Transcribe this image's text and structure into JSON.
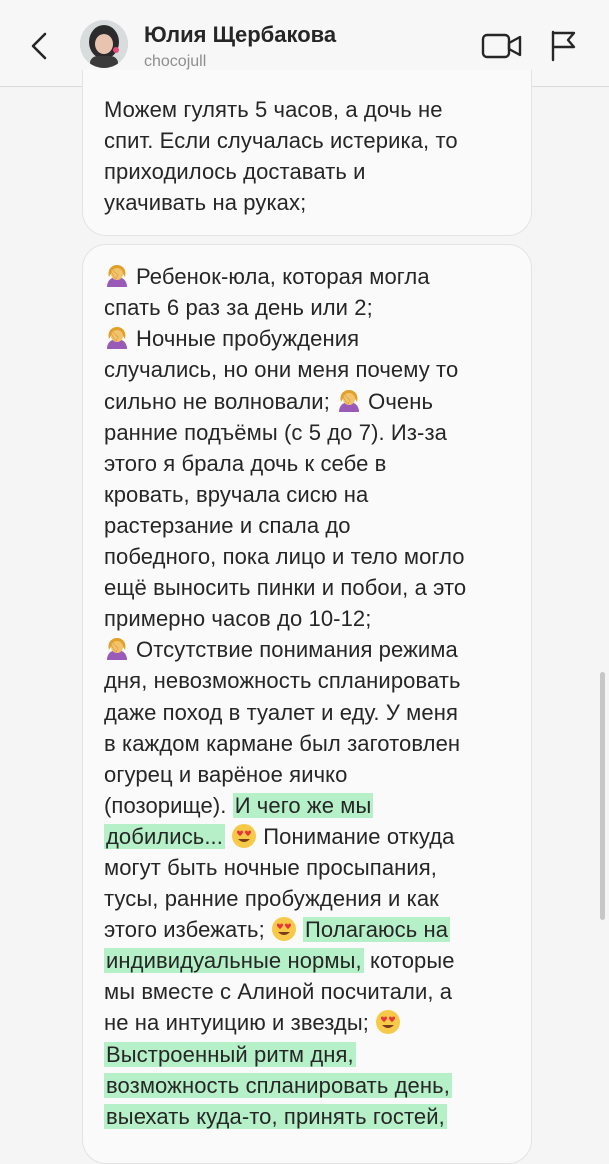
{
  "header": {
    "name": "Юлия Щербакова",
    "username": "chocojull"
  },
  "message1": {
    "lines": [
      "Можем гулять 5 часов, а дочь не",
      "спит. Если случалась истерика, то",
      "приходилось доставать и",
      "укачивать на руках;"
    ]
  },
  "message2": {
    "l1": "Ребенок-юла, которая могла",
    "l2": "спать 6 раз за день или 2;",
    "l3": "Ночные пробуждения",
    "l4": "случались, но они меня почему то",
    "l5a": "сильно не волновали;",
    "l5b": "Очень",
    "l6": "ранние подъёмы (с 5 до 7). Из-за",
    "l7": "этого я брала дочь к себе в",
    "l8": "кровать, вручала сисю на",
    "l9": "растерзание и спала до",
    "l10": "победного, пока лицо и тело могло",
    "l11": "ещё выносить пинки и побои, а это",
    "l12": "примерно часов до 10-12;",
    "l13": "Отсутствие понимания режима",
    "l14": "дня, невозможность спланировать",
    "l15": "даже поход в туалет и еду. У меня",
    "l16": "в каждом кармане был заготовлен",
    "l17": "огурец и варёное яичко",
    "l18a": "(позорище).",
    "l18b": "И чего же мы",
    "l19a": "добились...",
    "l19b": "Понимание откуда",
    "l20": "могут быть ночные просыпания,",
    "l21": "тусы, ранние пробуждения и как",
    "l22a": "этого избежать;",
    "l22b": "Полагаюсь на",
    "l23a": "индивидуальные нормы,",
    "l23b": "которые",
    "l24": "мы вместе с Алиной посчитали, а",
    "l25": "не на интуицию и звезды;",
    "l26": "Выстроенный ритм дня,",
    "l27": "возможность спланировать день,",
    "l28": "выехать куда-то, принять гостей,"
  },
  "icons": {
    "facepalm": "woman-facepalming-emoji",
    "heart_eyes": "heart-eyes-emoji"
  },
  "colors": {
    "highlight": "#b6f0c9",
    "bubble_border": "#e3e3e3",
    "text": "#262626",
    "muted": "#8e8e8e"
  }
}
